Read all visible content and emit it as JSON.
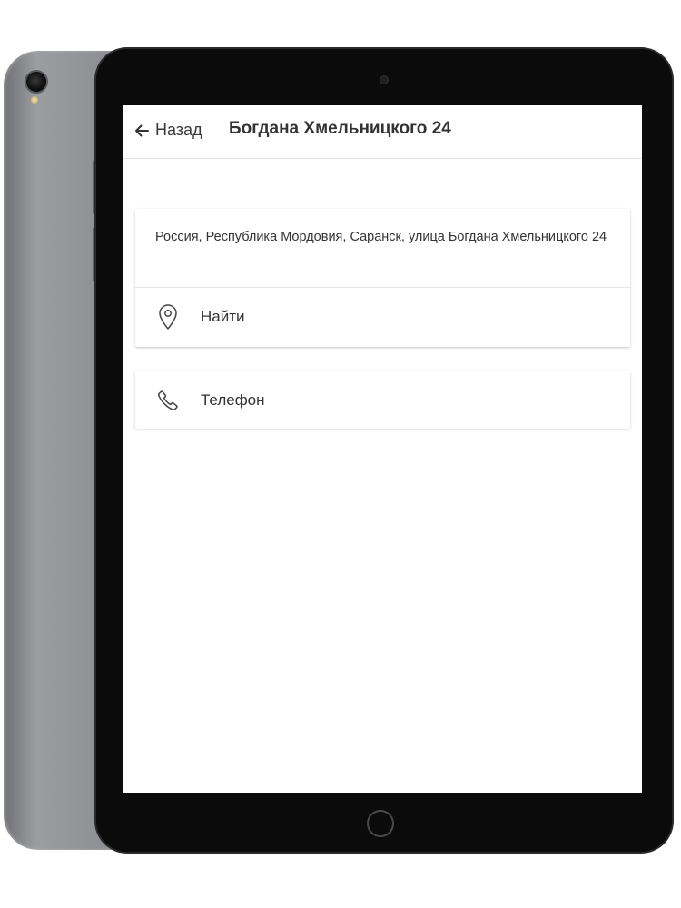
{
  "header": {
    "back_label": "Назад",
    "title": "Богдана Хмельницкого 24"
  },
  "address_card": {
    "address": "Россия, Республика Мордовия, Саранск, улица Богдана Хмельницкого 24",
    "find_label": "Найти",
    "find_icon": "location-pin-icon"
  },
  "phone_card": {
    "phone_label": "Телефон",
    "phone_icon": "phone-icon"
  },
  "colors": {
    "text": "#333333",
    "divider": "#e6e6e6",
    "bezel": "#0b0b0c",
    "shell": "#8d8e91"
  }
}
